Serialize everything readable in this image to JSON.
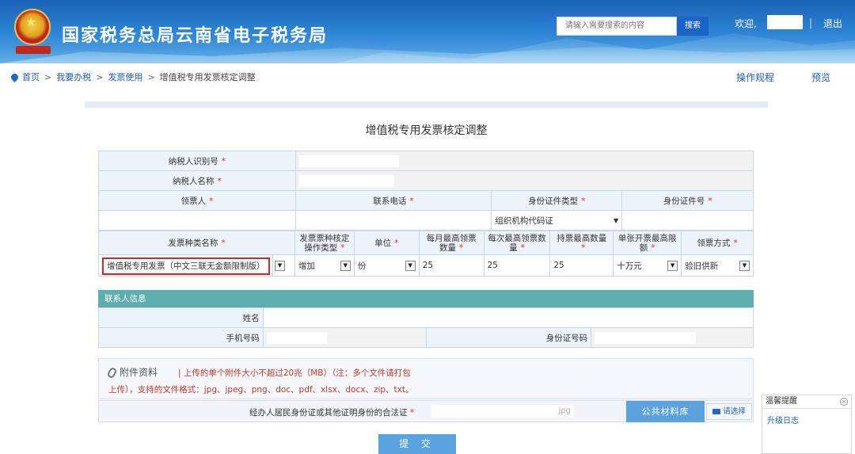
{
  "header": {
    "site_title": "国家税务总局云南省电子税务局",
    "search_placeholder": "请输入需要搜索的内容",
    "search_button": "搜索",
    "welcome": "欢迎,",
    "separator": "|",
    "logout": "退出",
    "brand_color": "#1a63b8"
  },
  "breadcrumb": {
    "items": [
      "首页",
      "我要办税",
      "发票使用",
      "增值税专用发票核定调整"
    ],
    "separator": ">"
  },
  "top_links": {
    "guide": "操作规程",
    "preview": "预览"
  },
  "form": {
    "title": "增值税专用发票核定调整",
    "taxpayer_id_label": "纳税人识别号",
    "taxpayer_name_label": "纳税人名称",
    "required_mark": "*",
    "recipient_label": "领票人",
    "phone_label": "联系电话",
    "id_type_label": "身份证件类型",
    "id_number_label": "身份证件号",
    "id_type_value": "组织机构代码证",
    "invoice_headers": {
      "invoice_type": "发票种类名称",
      "op_type": "发票票种核定操作类型",
      "unit": "单位",
      "monthly_max": "每月最高领票数量",
      "each_max": "每次最高领票数量",
      "hold_max": "持票最高数量",
      "single_limit": "单张开票最高限额",
      "method": "领票方式"
    },
    "invoice_row": {
      "invoice_type": "增值税专用发票（中文三联无金额限制版）",
      "op_type": "增加",
      "unit": "份",
      "monthly_max": "25",
      "each_max": "25",
      "hold_max": "25",
      "single_limit": "十万元",
      "method": "验旧供新"
    }
  },
  "contact": {
    "section_title": "联系人信息",
    "name_label": "姓名",
    "mobile_label": "手机号码",
    "id_label": "身份证号码"
  },
  "attachment": {
    "title": "附件资料",
    "note_line1": "| 上传的单个附件大小不超过20兆（MB）（注：多个文件请打包",
    "note_line2": "上传），支持的文件格式：jpg、jpeg、png、doc、pdf、xlsx、docx、zip、txt。",
    "upload_label": "经办人居民身份证或其他证明身份的合法证",
    "upload_required": "*",
    "file_ext": "jpg",
    "public_library": "公共材料库",
    "choose": "请选择"
  },
  "submit_label": "提 交",
  "notice": {
    "title": "温馨提醒",
    "item": "升级日志",
    "close": "×"
  },
  "colors": {
    "section_header": "#5eaeb0",
    "highlight_border": "#d22222",
    "button_blue": "#5aa3de"
  }
}
